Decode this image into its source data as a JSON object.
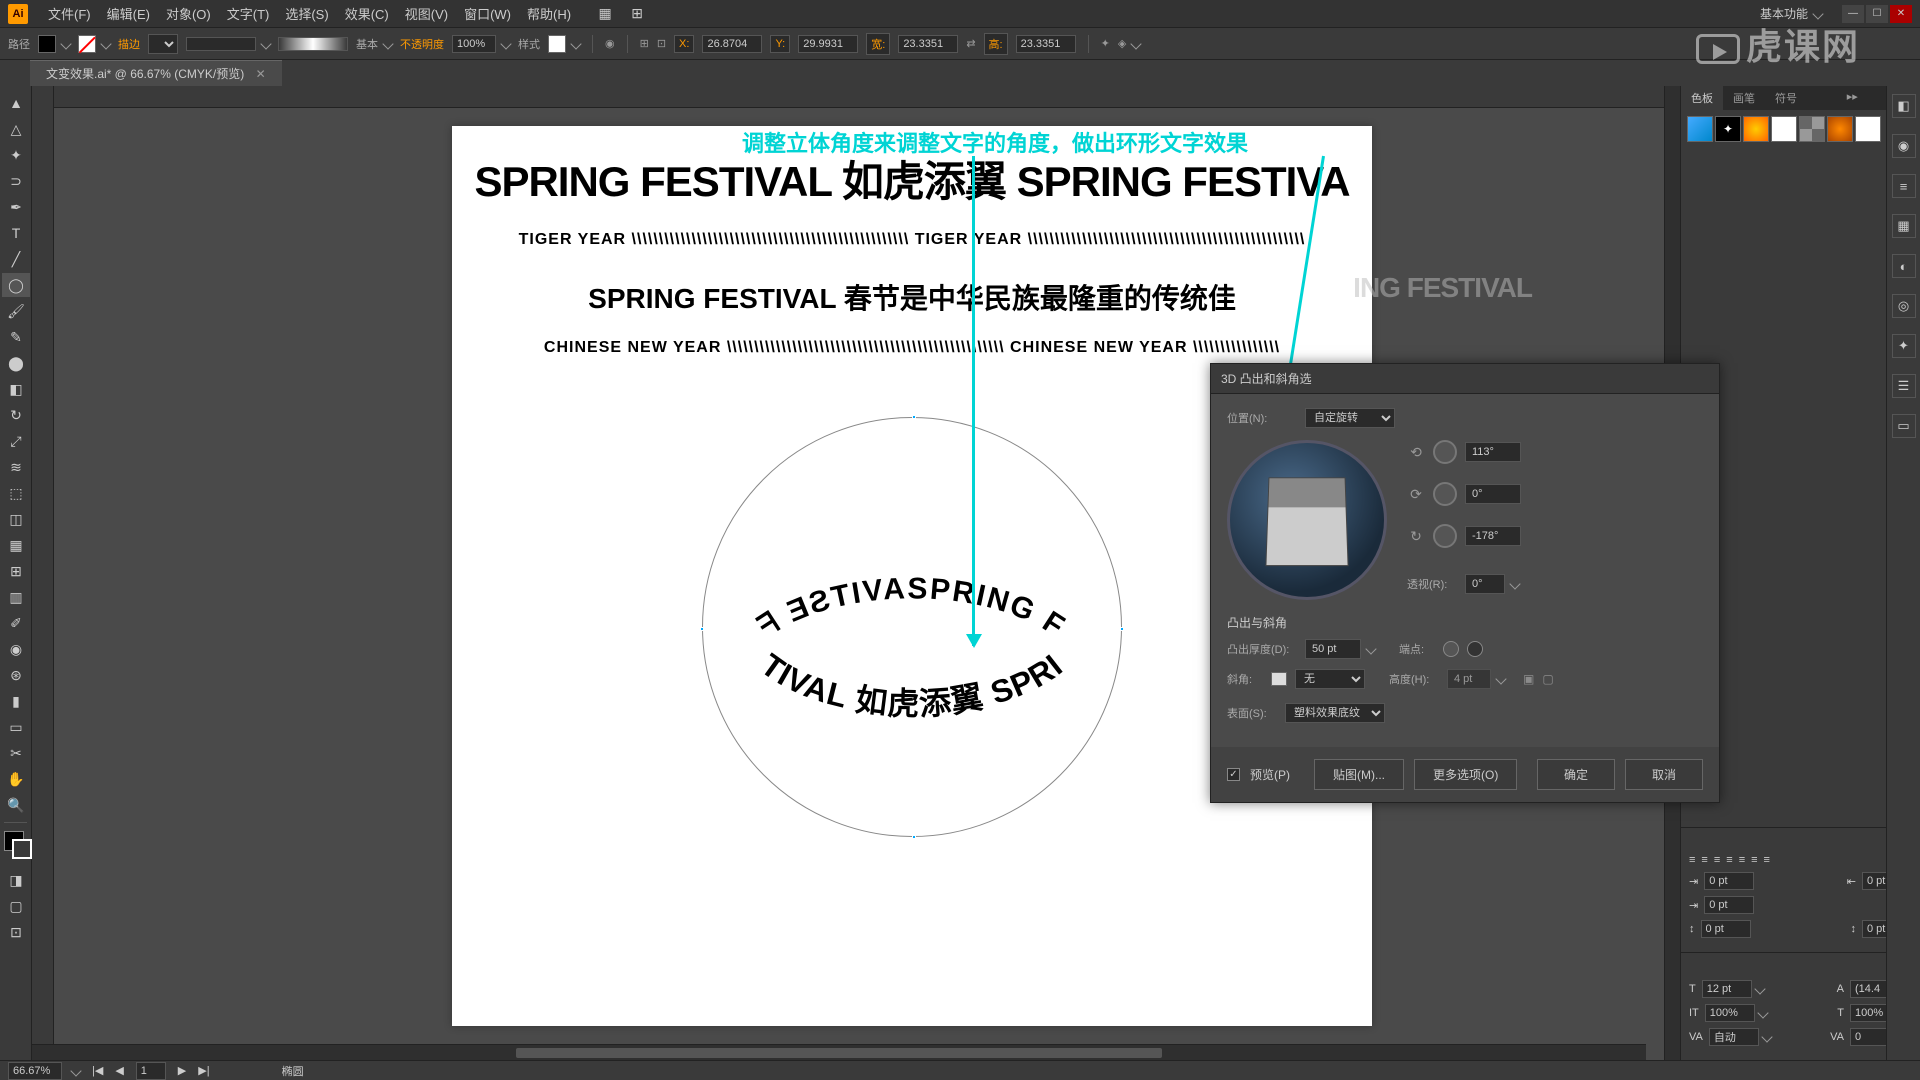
{
  "menu": {
    "file": "文件(F)",
    "edit": "编辑(E)",
    "object": "对象(O)",
    "type": "文字(T)",
    "select": "选择(S)",
    "effect": "效果(C)",
    "view": "视图(V)",
    "window": "窗口(W)",
    "help": "帮助(H)",
    "workspace": "基本功能"
  },
  "controlBar": {
    "path": "路径",
    "stroke": "描边",
    "basic": "基本",
    "opacity": "不透明度",
    "opacityVal": "100%",
    "style": "样式",
    "x": "26.8704",
    "y": "29.9931",
    "w": "23.3351",
    "h": "23.3351",
    "wLabel": "宽:",
    "hLabel": "高:",
    "xIcon": "X:",
    "yIcon": "Y:"
  },
  "docTab": "文变效果.ai* @ 66.67% (CMYK/预览)",
  "annotation": "调整立体角度来调整文字的角度，做出环形文字效果",
  "artboard": {
    "title": "SPRING FESTIVAL 如虎添翼 SPRING FESTIVA",
    "sub1": "TIGER YEAR \\\\\\\\\\\\\\\\\\\\\\\\\\\\\\\\\\\\\\\\\\\\\\\\\\\\\\\\\\\\\\\\\\\\\\\\\\\\\\\\\\\\\\\\\\\\\\\\\\\\\\ TIGER YEAR \\\\\\\\\\\\\\\\\\\\\\\\\\\\\\\\\\\\\\\\\\\\\\\\\\\\\\\\\\\\\\\\\\\\\\\\\\\\\\\\\\\\\\\\\\\\\\\\\\\\\\",
    "mid": "SPRING FESTIVAL 春节是中华民族最隆重的传统佳",
    "sub2": "CHINESE NEW YEAR \\\\\\\\\\\\\\\\\\\\\\\\\\\\\\\\\\\\\\\\\\\\\\\\\\\\\\\\\\\\\\\\\\\\\\\\\\\\\\\\\\\\\\\\\\\\\\\\\\\\\\ CHINESE NEW YEAR \\\\\\\\\\\\\\\\\\\\\\\\\\\\\\\\",
    "ghostRight": "ING FESTIVAL"
  },
  "dialog": {
    "title": "3D 凸出和斜角选  ",
    "posLabel": "位置(N):",
    "posValue": "自定旋转",
    "angleX": "113°",
    "angleY": "0°",
    "angleZ": "-178°",
    "perspLabel": "透视(R):",
    "perspValue": "0°",
    "extrudeSection": "凸出与斜角",
    "depthLabel": "凸出厚度(D):",
    "depthValue": "50 pt",
    "capLabel": "端点:",
    "bevelLabel": "斜角:",
    "bevelValue": "无",
    "heightLabel": "高度(H):",
    "heightValue": "4 pt",
    "surfaceLabel": "表面(S):",
    "surfaceValue": "塑料效果底纹",
    "preview": "预览(P)",
    "map": "贴图(M)...",
    "more": "更多选项(O)",
    "ok": "确定",
    "cancel": "取消"
  },
  "rightPanel": {
    "tab1": "色板",
    "tab2": "画笔",
    "tab3": "符号",
    "charSize": "12 pt",
    "leading": "(14.4",
    "scaleH": "100%",
    "scaleV": "100%",
    "tracking": "自动",
    "kerning": "0",
    "indent1": "0 pt",
    "indent2": "0 pt"
  },
  "status": {
    "zoom": "66.67%",
    "page": "1",
    "tool": "椭圆"
  },
  "watermark": "虎课网"
}
